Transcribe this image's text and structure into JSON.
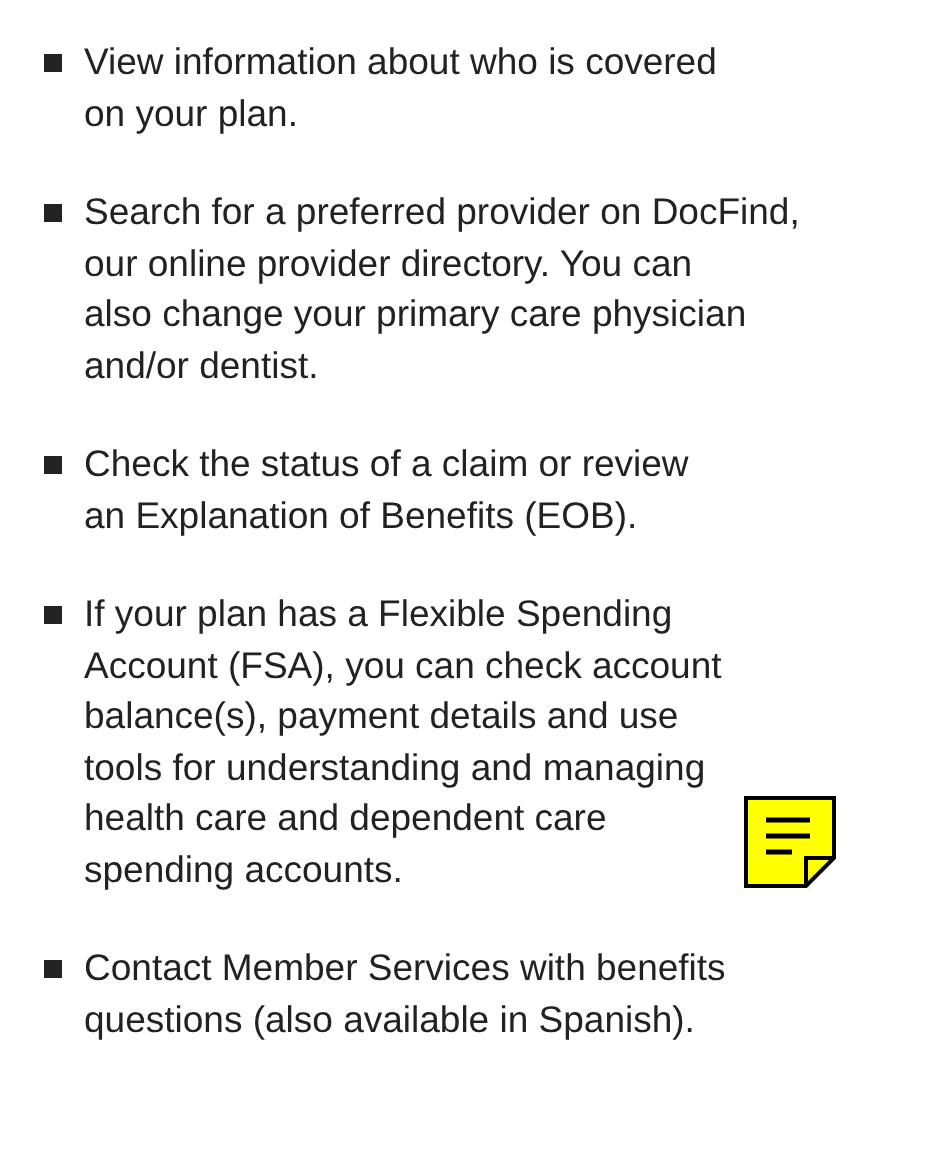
{
  "items": [
    {
      "lines": [
        "View information about who is covered",
        "on your plan."
      ]
    },
    {
      "lines": [
        "Search for a preferred provider on DocFind,",
        "our online provider directory. You can",
        "also change your primary care physician",
        "and/or dentist."
      ]
    },
    {
      "lines": [
        "Check the status of a claim or review",
        "an Explanation of Benefits (EOB)."
      ]
    },
    {
      "lines": [
        "If your plan has a Flexible Spending",
        "Account (FSA), you can check account",
        "balance(s), payment details and use",
        "tools for understanding and managing",
        "health care and dependent care",
        "spending accounts."
      ],
      "note": true
    },
    {
      "lines": [
        "Contact Member Services with benefits",
        "questions (also available in Spanish)."
      ]
    }
  ]
}
